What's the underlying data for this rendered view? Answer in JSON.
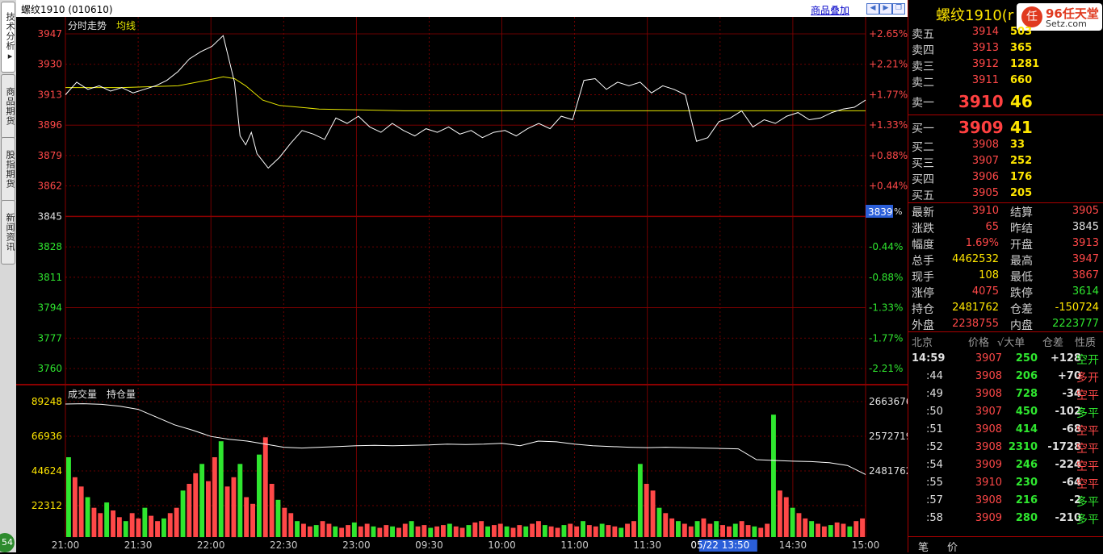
{
  "left_tabs": [
    {
      "label": "技术分析▸",
      "active": true
    },
    {
      "label": "商品期货",
      "active": false
    },
    {
      "label": "股指期货",
      "active": false
    },
    {
      "label": "新闻资讯",
      "active": false
    }
  ],
  "corner_badge": "54",
  "window_title": "螺纹1910 (010610)",
  "overlay_link": "商品叠加",
  "nav_icons": [
    "left-arrow-icon",
    "right-arrow-icon",
    "restore-icon"
  ],
  "price_panel": {
    "labels": [
      "分时走势",
      "均线"
    ],
    "left_axis": [
      "3947",
      "3930",
      "3913",
      "3896",
      "3879",
      "3862",
      "3845",
      "3828",
      "3811",
      "3794",
      "3777",
      "3760"
    ],
    "right_axis": [
      "+2.65%",
      "+2.21%",
      "+1.77%",
      "+1.33%",
      "+0.88%",
      "+0.44%",
      "",
      "-0.44%",
      "-0.88%",
      "-1.33%",
      "-1.77%",
      "-2.21%"
    ],
    "cursor_price": "3839",
    "pct_stub": "%"
  },
  "volume_panel": {
    "labels": [
      "成交量",
      "持仓量"
    ],
    "left_axis": [
      "89248",
      "66936",
      "44624",
      "22312"
    ],
    "right_axis": [
      "2663676",
      "2572719",
      "2481762"
    ]
  },
  "time_axis": [
    "21:00",
    "21:30",
    "22:00",
    "22:30",
    "23:00",
    "09:30",
    "10:00",
    "11:00",
    "11:30",
    "05/22 13:50",
    "14:30",
    "15:00"
  ],
  "colors": {
    "up": "#ff4848",
    "down": "#2fe62f",
    "price_line": "#ffffff",
    "avg_line": "#e6e600",
    "grid": "#8a0000"
  },
  "chart_data": {
    "type": "line",
    "series": [
      {
        "name": "分时走势",
        "x": [
          0,
          4,
          8,
          12,
          16,
          20,
          24,
          28,
          32,
          36,
          40,
          44,
          48,
          52,
          56,
          60,
          62,
          64,
          66,
          68,
          70,
          72,
          76,
          80,
          84,
          88,
          92,
          96,
          100,
          104,
          108,
          112,
          116,
          120,
          124,
          128,
          132,
          136,
          140,
          144,
          148,
          152,
          156,
          160,
          164,
          168,
          172,
          176,
          180,
          184,
          188,
          192,
          196,
          200,
          204,
          208,
          212,
          216,
          220,
          224,
          228,
          232,
          236,
          240,
          244,
          248,
          252,
          256,
          260,
          264,
          268,
          272,
          276,
          280,
          284
        ],
        "y": [
          3913,
          3920,
          3916,
          3918,
          3915,
          3917,
          3914,
          3916,
          3918,
          3921,
          3926,
          3933,
          3937,
          3940,
          3946,
          3920,
          3890,
          3885,
          3892,
          3880,
          3876,
          3872,
          3878,
          3886,
          3893,
          3891,
          3888,
          3900,
          3897,
          3901,
          3895,
          3892,
          3897,
          3893,
          3890,
          3894,
          3892,
          3895,
          3891,
          3893,
          3889,
          3892,
          3893,
          3890,
          3894,
          3897,
          3894,
          3901,
          3899,
          3921,
          3922,
          3916,
          3920,
          3918,
          3920,
          3914,
          3918,
          3916,
          3913,
          3887,
          3889,
          3898,
          3900,
          3904,
          3895,
          3899,
          3897,
          3901,
          3903,
          3899,
          3900,
          3903,
          3905,
          3906,
          3910
        ]
      },
      {
        "name": "均线",
        "x": [
          0,
          20,
          40,
          50,
          56,
          60,
          64,
          70,
          76,
          90,
          120,
          160,
          200,
          240,
          284
        ],
        "y": [
          3917,
          3917,
          3918,
          3921,
          3923,
          3922,
          3918,
          3910,
          3907,
          3905,
          3904,
          3904,
          3904,
          3904,
          3904
        ]
      }
    ],
    "volume": [
      60,
      45,
      38,
      30,
      22,
      18,
      26,
      20,
      15,
      12,
      18,
      14,
      22,
      16,
      12,
      14,
      18,
      22,
      35,
      40,
      48,
      55,
      42,
      60,
      72,
      38,
      45,
      55,
      30,
      25,
      62,
      75,
      40,
      28,
      22,
      18,
      12,
      10,
      8,
      9,
      12,
      10,
      8,
      7,
      9,
      11,
      8,
      10,
      8,
      7,
      9,
      8,
      7,
      10,
      12,
      8,
      9,
      7,
      8,
      9,
      10,
      8,
      7,
      9,
      11,
      12,
      8,
      9,
      10,
      8,
      7,
      9,
      8,
      10,
      12,
      9,
      8,
      7,
      9,
      10,
      8,
      12,
      9,
      8,
      10,
      9,
      8,
      7,
      10,
      12,
      55,
      40,
      35,
      22,
      18,
      14,
      12,
      10,
      8,
      12,
      14,
      10,
      12,
      9,
      8,
      10,
      12,
      9,
      8,
      7,
      10,
      92,
      35,
      30,
      22,
      18,
      14,
      12,
      10,
      8,
      9,
      11,
      10,
      8,
      12,
      14
    ],
    "open_interest": [
      2663676,
      2664500,
      2662900,
      2658000,
      2650000,
      2630000,
      2610000,
      2596000,
      2580000,
      2572719,
      2568000,
      2560000,
      2552000,
      2550000,
      2552000,
      2554000,
      2556000,
      2557000,
      2556000,
      2557000,
      2558000,
      2560000,
      2559000,
      2560000,
      2562000,
      2556000,
      2568000,
      2566000,
      2560000,
      2556000,
      2554000,
      2552000,
      2551000,
      2552000,
      2551000,
      2550000,
      2549000,
      2548000,
      2520000,
      2518000,
      2516000,
      2515000,
      2512000,
      2505000,
      2481762
    ],
    "ylim": [
      3760,
      3947
    ],
    "grid": true
  },
  "quote": {
    "name": "螺纹1910(r",
    "logo_brand": "96任天堂",
    "logo_sub": "Setz.com",
    "logo_mark": "任",
    "asks": [
      {
        "label": "卖五",
        "price": "3914",
        "vol": "503"
      },
      {
        "label": "卖四",
        "price": "3913",
        "vol": "365"
      },
      {
        "label": "卖三",
        "price": "3912",
        "vol": "1281"
      },
      {
        "label": "卖二",
        "price": "3911",
        "vol": "660"
      }
    ],
    "ask1": {
      "label": "卖一",
      "price": "3910",
      "vol": "46"
    },
    "bid1": {
      "label": "买一",
      "price": "3909",
      "vol": "41"
    },
    "bids": [
      {
        "label": "买二",
        "price": "3908",
        "vol": "33"
      },
      {
        "label": "买三",
        "price": "3907",
        "vol": "252"
      },
      {
        "label": "买四",
        "price": "3906",
        "vol": "176"
      },
      {
        "label": "买五",
        "price": "3905",
        "vol": "205"
      }
    ],
    "stats": [
      {
        "k1": "最新",
        "v1": "3910",
        "c1": "red",
        "k2": "结算",
        "v2": "3905",
        "c2": "red"
      },
      {
        "k1": "涨跌",
        "v1": "65",
        "c1": "red",
        "k2": "昨结",
        "v2": "3845",
        "c2": "white"
      },
      {
        "k1": "幅度",
        "v1": "1.69%",
        "c1": "red",
        "k2": "开盘",
        "v2": "3913",
        "c2": "red"
      },
      {
        "k1": "总手",
        "v1": "4462532",
        "c1": "yel",
        "k2": "最高",
        "v2": "3947",
        "c2": "red"
      },
      {
        "k1": "现手",
        "v1": "108",
        "c1": "yel",
        "k2": "最低",
        "v2": "3867",
        "c2": "red"
      },
      {
        "k1": "涨停",
        "v1": "4075",
        "c1": "red",
        "k2": "跌停",
        "v2": "3614",
        "c2": "green"
      },
      {
        "k1": "持仓",
        "v1": "2481762",
        "c1": "yel",
        "k2": "仓差",
        "v2": "-150724",
        "c2": "yel"
      },
      {
        "k1": "外盘",
        "v1": "2238755",
        "c1": "red",
        "k2": "内盘",
        "v2": "2223777",
        "c2": "green"
      }
    ]
  },
  "trades_header": [
    "北京",
    "价格",
    "√大单",
    "仓差",
    "性质"
  ],
  "trades": [
    {
      "time": "14:59",
      "price": "3907",
      "vol": "250",
      "diff": "+128",
      "type": "空开",
      "tc": "green"
    },
    {
      "time": ":44",
      "price": "3908",
      "vol": "206",
      "diff": "+70",
      "type": "多开",
      "tc": "red"
    },
    {
      "time": ":49",
      "price": "3908",
      "vol": "728",
      "diff": "-34",
      "type": "空平",
      "tc": "red"
    },
    {
      "time": ":50",
      "price": "3907",
      "vol": "450",
      "diff": "-102",
      "type": "多平",
      "tc": "green"
    },
    {
      "time": ":51",
      "price": "3908",
      "vol": "414",
      "diff": "-68",
      "type": "空平",
      "tc": "red"
    },
    {
      "time": ":52",
      "price": "3908",
      "vol": "2310",
      "diff": "-1728",
      "type": "空平",
      "tc": "red"
    },
    {
      "time": ":54",
      "price": "3909",
      "vol": "246",
      "diff": "-224",
      "type": "空平",
      "tc": "red"
    },
    {
      "time": ":55",
      "price": "3910",
      "vol": "230",
      "diff": "-64",
      "type": "空平",
      "tc": "red"
    },
    {
      "time": ":57",
      "price": "3908",
      "vol": "216",
      "diff": "-2",
      "type": "多平",
      "tc": "green"
    },
    {
      "time": ":58",
      "price": "3909",
      "vol": "280",
      "diff": "-210",
      "type": "多平",
      "tc": "green"
    }
  ],
  "bottom_tabs": [
    "笔",
    "价"
  ]
}
